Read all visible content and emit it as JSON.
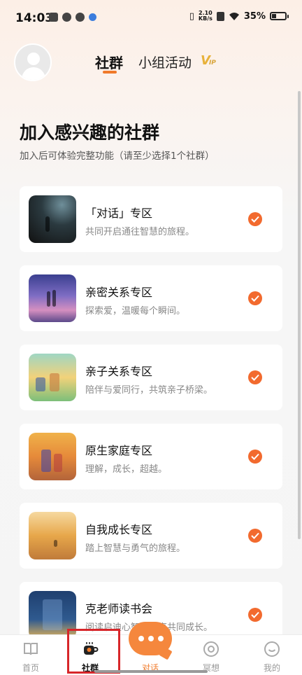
{
  "status_bar": {
    "time": "14:03",
    "net_speed_value": "2.10",
    "net_speed_unit": "KB/s",
    "battery": "35%"
  },
  "header": {
    "tabs": [
      {
        "label": "社群",
        "selected": true
      },
      {
        "label": "小组活动",
        "selected": false
      }
    ],
    "vip_badge": "VIP"
  },
  "page": {
    "title": "加入感兴趣的社群",
    "subtitle": "加入后可体验完整功能（请至少选择1个社群）"
  },
  "communities": [
    {
      "name": "「对话」专区",
      "desc": "共同开启通往智慧的旅程。",
      "checked": true
    },
    {
      "name": "亲密关系专区",
      "desc": "探索爱，温暖每个瞬间。",
      "checked": true
    },
    {
      "name": "亲子关系专区",
      "desc": "陪伴与爱同行，共筑亲子桥梁。",
      "checked": true
    },
    {
      "name": "原生家庭专区",
      "desc": "理解，成长，超越。",
      "checked": true
    },
    {
      "name": "自我成长专区",
      "desc": "踏上智慧与勇气的旅程。",
      "checked": true
    },
    {
      "name": "克老师读书会",
      "desc": "阅读启迪心智，分享共同成长。",
      "checked": true
    }
  ],
  "bottom_nav": [
    {
      "label": "首页",
      "icon": "book-icon"
    },
    {
      "label": "社群",
      "icon": "cup-icon",
      "selected": true
    },
    {
      "label": "对话",
      "icon": "chat-bubble-icon"
    },
    {
      "label": "冥想",
      "icon": "meditate-icon"
    },
    {
      "label": "我的",
      "icon": "smile-face-icon"
    }
  ],
  "colors": {
    "accent": "#f07a2a",
    "check": "#f26a2e",
    "highlight_box": "#d7262a"
  }
}
